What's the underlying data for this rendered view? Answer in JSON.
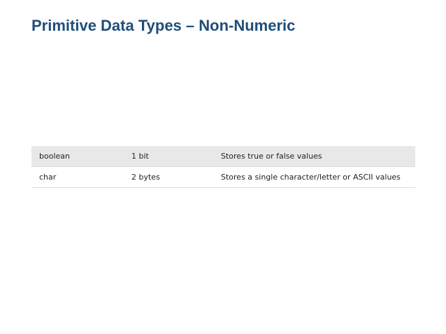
{
  "slide": {
    "title": "Primitive Data Types – Non-Numeric"
  },
  "table": {
    "rows": [
      {
        "type": "boolean",
        "size": "1 bit",
        "description": "Stores true or false values"
      },
      {
        "type": "char",
        "size": "2 bytes",
        "description": "Stores a single character/letter or ASCII values"
      }
    ]
  }
}
